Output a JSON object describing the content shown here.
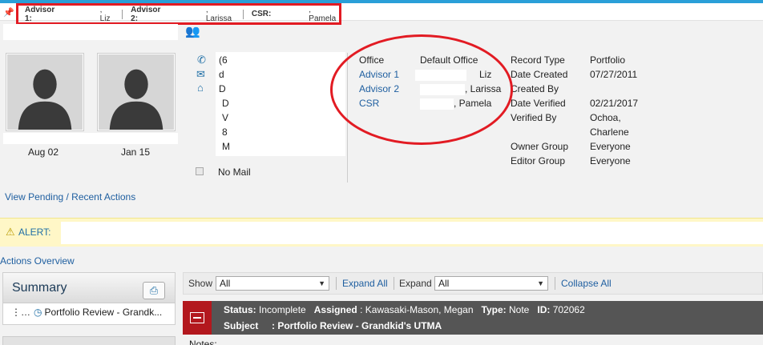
{
  "advisor_strip": {
    "advisor1_label": "Advisor 1:",
    "advisor1_value": ", Liz",
    "advisor2_label": "Advisor 2:",
    "advisor2_value": ", Larissa",
    "csr_label": "CSR:",
    "csr_value": ", Pamela"
  },
  "photos": [
    {
      "date": "Aug 02"
    },
    {
      "date": "Jan 15"
    }
  ],
  "contact": {
    "phone": "(6",
    "email": "d",
    "address_lines": [
      "D",
      "D",
      "V",
      "8",
      "M"
    ],
    "no_mail_label": "No Mail"
  },
  "info": {
    "office_label": "Office",
    "office_value": "Default Office",
    "advisor1_label": "Advisor 1",
    "advisor1_value": "Liz",
    "advisor2_label": "Advisor 2",
    "advisor2_value": ", Larissa",
    "csr_label": "CSR",
    "csr_value": ", Pamela",
    "record_type_label": "Record Type",
    "record_type_value": "Portfolio",
    "date_created_label": "Date Created",
    "date_created_value": "07/27/2011",
    "created_by_label": "Created By",
    "date_verified_label": "Date Verified",
    "date_verified_value": "02/21/2017",
    "verified_by_label": "Verified By",
    "verified_by_value_1": "Ochoa,",
    "verified_by_value_2": "Charlene",
    "owner_group_label": "Owner Group",
    "owner_group_value": "Everyone",
    "editor_group_label": "Editor Group",
    "editor_group_value": "Everyone"
  },
  "pending_link": "View Pending / Recent Actions",
  "alert": {
    "label": "ALERT:"
  },
  "actions_overview": {
    "title": "Actions Overview",
    "summary_title": "Summary",
    "tree_item": "Portfolio Review - Grandk..."
  },
  "toolbar": {
    "show_label": "Show",
    "show_value": "All",
    "expand_all": "Expand All",
    "expand_label": "Expand",
    "expand_value": "All",
    "collapse_all": "Collapse All"
  },
  "task": {
    "status_label": "Status:",
    "status_value": "Incomplete",
    "assigned_label": "Assigned",
    "assigned_value": ": Kawasaki-Mason, Megan",
    "type_label": "Type:",
    "type_value": "Note",
    "id_label": "ID:",
    "id_value": "702062",
    "subject_label": "Subject",
    "subject_value": ": Portfolio Review - Grandkid's UTMA",
    "notes_label": "Notes:"
  },
  "colors": {
    "accent_blue": "#1f5fa0",
    "highlight_red": "#e21b23",
    "alert_yellow": "#fff7c7",
    "task_bar": "#555555",
    "toggle_red": "#b3181e"
  }
}
